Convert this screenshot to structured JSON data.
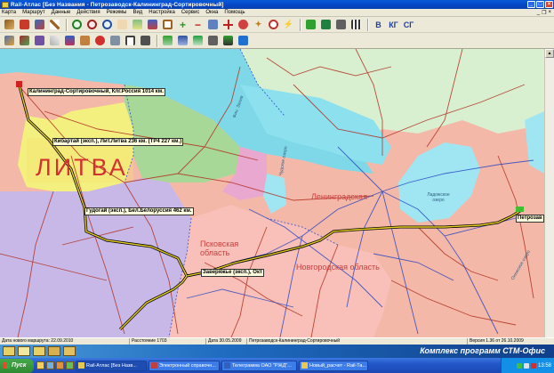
{
  "window": {
    "title": "Rail-Атлас  [Без Названия  -  Петрозаводск-Калининград-Сортировочный]"
  },
  "menu": [
    "Карта",
    "Маршрут",
    "Данные",
    "Действия",
    "Режимы",
    "Вид",
    "Настройка",
    "Сервис",
    "Окна",
    "Помощь"
  ],
  "toolbar": {
    "text_buttons": [
      "В",
      "КГ",
      "СГ"
    ]
  },
  "map": {
    "stations": [
      "Калининград-Сортировочный, Клг.Россия 1014 км.",
      "Кибартай (эксп.), Лит.Литва 236 км. (ТР4 227 км.)",
      "Гудогай (эксп.), Бел.Белоруссия 462 км.",
      "Заверяжье (эксп.), Окт",
      "Петрозав"
    ],
    "regions": {
      "lithuania": "ЛИТВА",
      "leningrad": "Ленинградская",
      "pskov": "Псковская область",
      "novgorod": "Новгородская область"
    },
    "water": [
      "Ладожское озеро",
      "Фин. Залив",
      "Чудское озеро",
      "Онежское озеро"
    ]
  },
  "statusbar": [
    "Дата нового маршрута: 22.09.2010",
    "Расстояние 1703",
    "Дата 30.05.2009",
    "Петрозаводск-Калининград-Сортировочный",
    "Версия 1.36 от 26.10.2009"
  ],
  "banner": {
    "text": "Комплекс программ СТМ-Офис"
  },
  "taskbar": {
    "start": "Пуск",
    "tasks": [
      "Rail-Атлас  [Без Назв...",
      "Электронный справочн...",
      "Телеграмма ОАО \"РЖД\"...",
      "Новый_расчет - Rail-Та..."
    ],
    "clock": "13:58"
  }
}
